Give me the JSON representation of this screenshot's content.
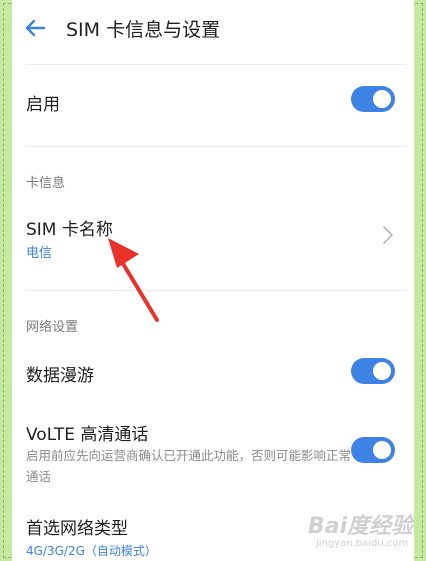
{
  "header": {
    "title": "SIM 卡信息与设置"
  },
  "enable_row": {
    "label": "启用",
    "toggle_on": true
  },
  "card_info": {
    "section_label": "卡信息",
    "sim_name_label": "SIM 卡名称",
    "sim_name_value": "电信"
  },
  "network": {
    "section_label": "网络设置",
    "data_roaming_label": "数据漫游",
    "data_roaming_on": true,
    "volte_label": "VoLTE 高清通话",
    "volte_description": "启用前应先向运营商确认已开通此功能，否则可能影响正常通话",
    "volte_on": true,
    "preferred_network_label": "首选网络类型",
    "preferred_network_value": "4G/3G/2G（自动模式）"
  },
  "watermark": {
    "text": "Bai度经验",
    "sub": "jingyan.baidu.com"
  },
  "colors": {
    "accent": "#3e82e6",
    "annotation_arrow": "#e8322a",
    "border": "#c6e9a2"
  }
}
